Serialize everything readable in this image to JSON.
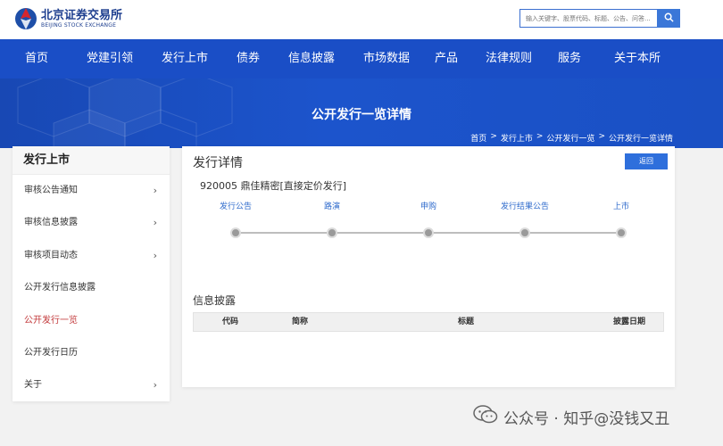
{
  "header": {
    "logo_cn": "北京证券交易所",
    "logo_en": "BEIJING STOCK EXCHANGE",
    "search_placeholder": "输入关键字、股票代码、标题、公告、问答..."
  },
  "nav": [
    "首页",
    "党建引领",
    "发行上市",
    "债券",
    "信息披露",
    "市场数据",
    "产品",
    "法律规则",
    "服务",
    "关于本所"
  ],
  "banner": {
    "title": "公开发行一览详情",
    "breadcrumb": [
      "首页",
      ">",
      "发行上市",
      ">",
      "公开发行一览",
      ">",
      "公开发行一览详情"
    ]
  },
  "sidebar": {
    "title": "发行上市",
    "items": [
      {
        "label": "审核公告通知",
        "chevron": "›"
      },
      {
        "label": "审核信息披露",
        "chevron": "›"
      },
      {
        "label": "审核项目动态",
        "chevron": "›"
      },
      {
        "label": "公开发行信息披露",
        "chevron": ""
      },
      {
        "label": "公开发行一览",
        "chevron": ""
      },
      {
        "label": "公开发行日历",
        "chevron": ""
      },
      {
        "label": "关于",
        "chevron": "›"
      }
    ]
  },
  "main": {
    "title": "发行详情",
    "back_label": "返回",
    "stock_title": "920005 鼎佳精密[直接定价发行]",
    "steps": [
      "发行公告",
      "路演",
      "申购",
      "发行结果公告",
      "上市"
    ],
    "info_title": "信息披露",
    "table_headers": [
      "代码",
      "简称",
      "标题",
      "披露日期"
    ]
  },
  "watermark": "公众号 · 知乎@没钱又丑",
  "colors": {
    "nav": "#1a4ec6",
    "accent": "#2e6fdc",
    "active": "#c2383a",
    "step_label": "#2f6bcc"
  }
}
